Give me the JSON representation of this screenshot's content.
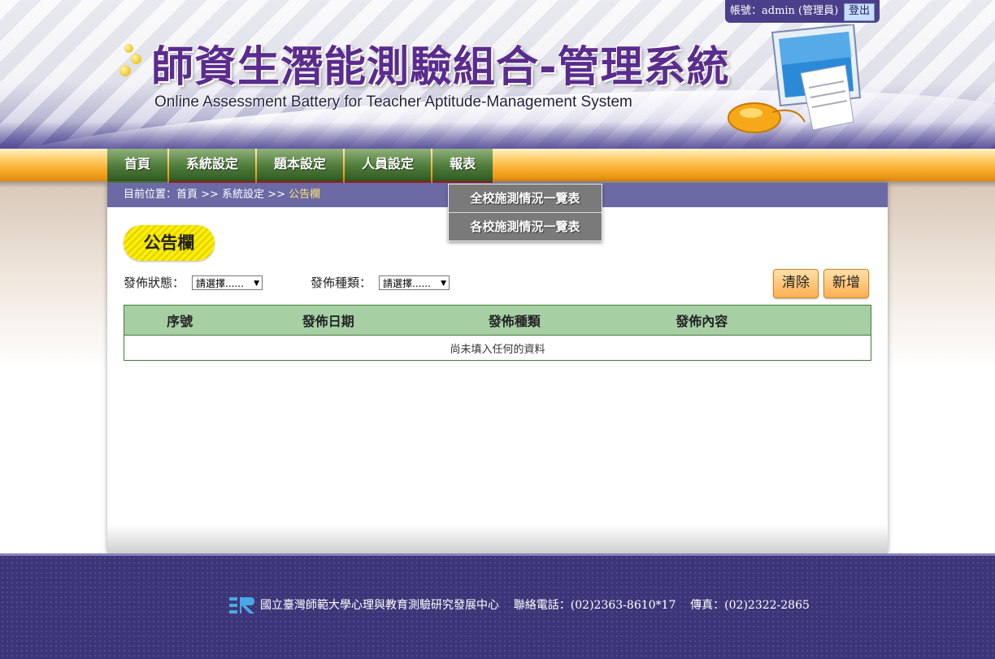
{
  "header": {
    "title_cn": "師資生潛能測驗組合-管理系統",
    "title_en": "Online Assessment Battery for Teacher Aptitude-Management System",
    "account_text": "帳號：admin (管理員)",
    "logout_label": "登出"
  },
  "nav": {
    "items": [
      {
        "label": "首頁"
      },
      {
        "label": "系統設定"
      },
      {
        "label": "題本設定"
      },
      {
        "label": "人員設定"
      },
      {
        "label": "報表"
      }
    ],
    "dropdown": [
      {
        "label": "全校施測情況一覽表"
      },
      {
        "label": "各校施測情況一覽表"
      }
    ]
  },
  "breadcrumb": {
    "prefix": "目前位置：首頁 >> 系統設定 >> ",
    "current": "公告欄"
  },
  "page": {
    "title": "公告欄",
    "filters": {
      "status_label": "發佈狀態：",
      "status_value": "請選擇......",
      "type_label": "發佈種類：",
      "type_value": "請選擇......"
    },
    "buttons": {
      "clear": "清除",
      "add": "新增"
    },
    "table": {
      "headers": [
        "序號",
        "發佈日期",
        "發佈種類",
        "發佈內容"
      ],
      "empty_text": "尚未填入任何的資料"
    }
  },
  "footer": {
    "org": "國立臺灣師範大學心理與教育測驗研究發展中心",
    "phone": "聯絡電話：(02)2363-8610*17",
    "fax": "傳真：(02)2322-2865"
  },
  "colors": {
    "nav_green": "#4e7b3a",
    "accent_orange": "#f6a623",
    "breadcrumb_bg": "#6b6aa5",
    "table_header_bg": "#a6cfa4",
    "footer_bg": "#3c3578"
  }
}
